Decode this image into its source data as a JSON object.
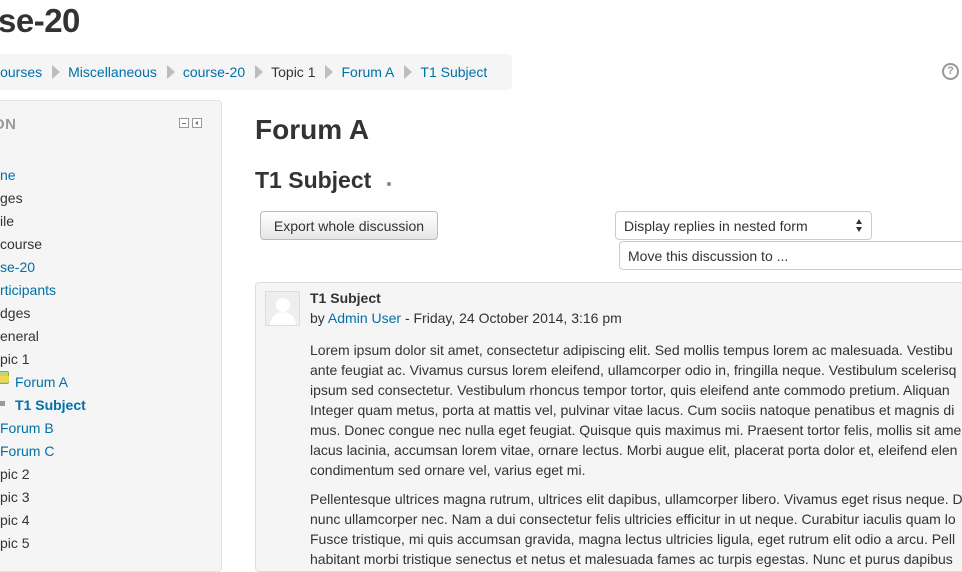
{
  "page": {
    "course_title": "se-20"
  },
  "breadcrumb": {
    "items": [
      {
        "label": "Courses",
        "link": true
      },
      {
        "label": "Miscellaneous",
        "link": true
      },
      {
        "label": "course-20",
        "link": true
      },
      {
        "label": "Topic 1",
        "link": false
      },
      {
        "label": "Forum A",
        "link": true
      },
      {
        "label": "T1 Subject",
        "link": true
      }
    ],
    "help_icon": "?"
  },
  "navigation": {
    "header": "ON",
    "items": [
      {
        "label": "ne",
        "link": true
      },
      {
        "label": "ges",
        "link": false
      },
      {
        "label": "ile",
        "link": false
      },
      {
        "label": " course",
        "link": false
      },
      {
        "label": "se-20",
        "link": true
      },
      {
        "label": "rticipants",
        "link": true
      },
      {
        "label": "dges",
        "link": false
      },
      {
        "label": "eneral",
        "link": false
      },
      {
        "label": "pic 1",
        "link": false
      },
      {
        "label": "Forum A",
        "link": true,
        "icon": "forum-icon"
      },
      {
        "label": "T1 Subject",
        "link": true,
        "bold": true,
        "icon": "bullet-icon"
      },
      {
        "label": "Forum B",
        "link": true
      },
      {
        "label": "Forum C",
        "link": true
      },
      {
        "label": "pic 2",
        "link": false
      },
      {
        "label": "pic 3",
        "link": false
      },
      {
        "label": "pic 4",
        "link": false
      },
      {
        "label": "pic 5",
        "link": false
      }
    ]
  },
  "main": {
    "forum_name": "Forum A",
    "discussion_title": "T1 Subject",
    "export_button": "Export whole discussion",
    "display_mode_select": "Display replies in nested form",
    "move_select": "Move this discussion to ..."
  },
  "post": {
    "subject": "T1 Subject",
    "by_prefix": "by",
    "author": "Admin User",
    "date": " - Friday, 24 October 2014, 3:16 pm",
    "paragraph1": [
      "Lorem ipsum dolor sit amet, consectetur adipiscing elit. Sed mollis tempus lorem ac malesuada. Vestibu",
      "ante feugiat ac. Vivamus cursus lorem eleifend, ullamcorper odio in, fringilla neque. Vestibulum scelerisq",
      "ipsum sed consectetur. Vestibulum rhoncus tempor tortor, quis eleifend ante commodo pretium. Aliquan",
      "Integer quam metus, porta at mattis vel, pulvinar vitae lacus. Cum sociis natoque penatibus et magnis di",
      "mus. Donec congue nec nulla eget feugiat. Quisque quis maximus mi. Praesent tortor felis, mollis sit ame",
      "lacus lacinia, accumsan lorem vitae, ornare lectus. Morbi augue elit, placerat porta dolor et, eleifend elen",
      "condimentum sed ornare vel, varius eget mi."
    ],
    "paragraph2": [
      "Pellentesque ultrices magna rutrum, ultrices elit dapibus, ullamcorper libero. Vivamus eget risus neque. D",
      "nunc ullamcorper nec. Nam a dui consectetur felis ultricies efficitur in ut neque. Curabitur iaculis quam lo",
      "Fusce tristique, mi quis accumsan gravida, magna lectus ultricies ligula, eget rutrum elit odio a arcu. Pell",
      "habitant morbi tristique senectus et netus et malesuada fames ac turpis egestas. Nunc et purus dapibus"
    ]
  }
}
